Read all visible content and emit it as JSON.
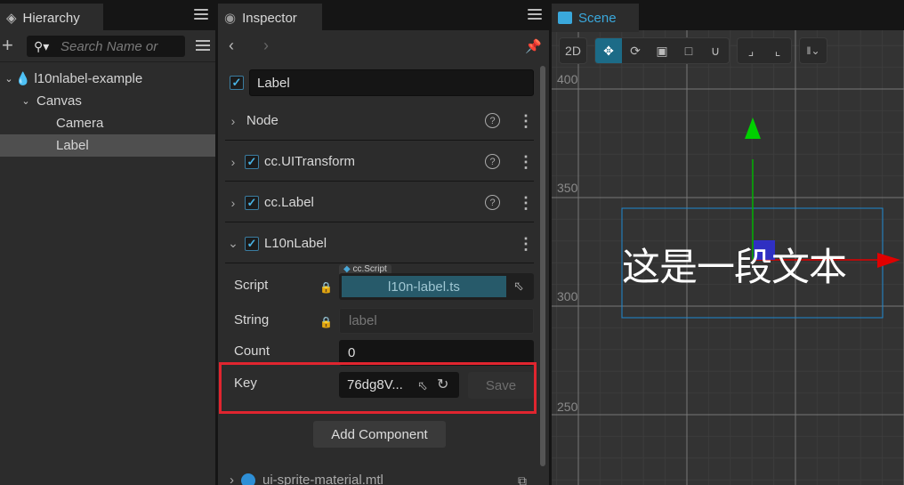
{
  "hierarchy": {
    "title": "Hierarchy",
    "search_placeholder": "Search Name or",
    "tree": [
      {
        "label": "l10nlabel-example",
        "depth": 0,
        "expanded": true,
        "icon": "scene-flame-icon"
      },
      {
        "label": "Canvas",
        "depth": 1,
        "expanded": true
      },
      {
        "label": "Camera",
        "depth": 2
      },
      {
        "label": "Label",
        "depth": 2,
        "selected": true
      }
    ]
  },
  "inspector": {
    "title": "Inspector",
    "node_name": "Label",
    "node_enabled": true,
    "components": [
      {
        "title": "Node",
        "has_checkbox": false,
        "expanded": false,
        "has_help": true
      },
      {
        "title": "cc.UITransform",
        "has_checkbox": true,
        "expanded": false,
        "has_help": true
      },
      {
        "title": "cc.Label",
        "has_checkbox": true,
        "expanded": false,
        "has_help": true
      },
      {
        "title": "L10nLabel",
        "has_checkbox": true,
        "expanded": true,
        "has_help": false
      }
    ],
    "props": {
      "script_label": "Script",
      "script_type": "cc.Script",
      "script_value": "l10n-label.ts",
      "string_label": "String",
      "string_value": "label",
      "count_label": "Count",
      "count_value": "0",
      "key_label": "Key",
      "key_value": "76dg8V...",
      "save_label": "Save"
    },
    "add_component_label": "Add Component",
    "material": "ui-sprite-material.mtl"
  },
  "scene": {
    "title": "Scene",
    "mode_2d": "2D",
    "axis_labels": [
      "400",
      "350",
      "300",
      "250"
    ],
    "label_text": "这是一段文本",
    "colors": {
      "x_axis": "#e00000",
      "y_axis": "#00c000",
      "selection": "#1e88d0",
      "accent": "#3aa8dc"
    }
  }
}
